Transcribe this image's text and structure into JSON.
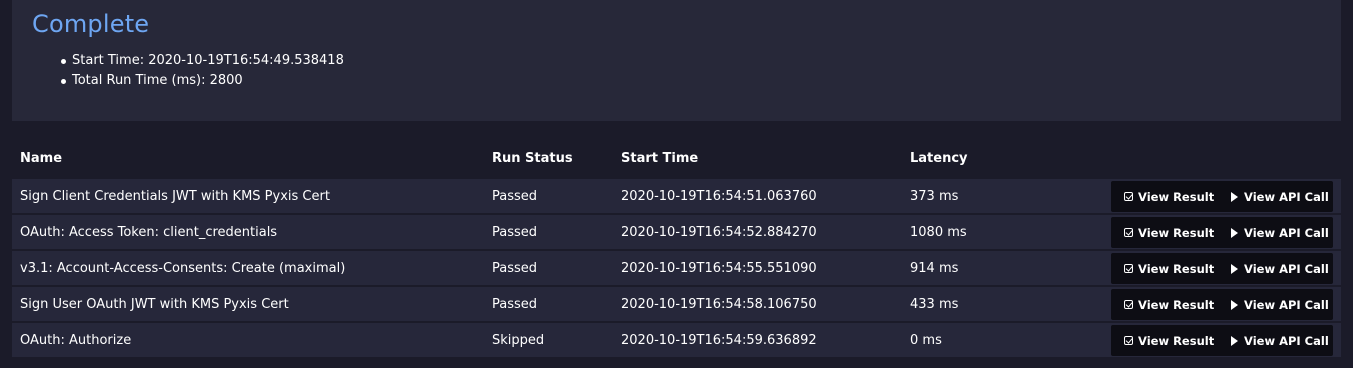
{
  "summary": {
    "status_title": "Complete",
    "start_time_label": "Start Time: 2020-10-19T16:54:49.538418",
    "total_run_time_label": "Total Run Time (ms): 2800"
  },
  "table": {
    "headers": {
      "name": "Name",
      "run_status": "Run Status",
      "start_time": "Start Time",
      "latency": "Latency"
    },
    "rows": [
      {
        "name": "Sign Client Credentials JWT with KMS Pyxis Cert",
        "status": "Passed",
        "start_time": "2020-10-19T16:54:51.063760",
        "latency": "373 ms"
      },
      {
        "name": "OAuth: Access Token: client_credentials",
        "status": "Passed",
        "start_time": "2020-10-19T16:54:52.884270",
        "latency": "1080 ms"
      },
      {
        "name": "v3.1: Account-Access-Consents: Create (maximal)",
        "status": "Passed",
        "start_time": "2020-10-19T16:54:55.551090",
        "latency": "914 ms"
      },
      {
        "name": "Sign User OAuth JWT with KMS Pyxis Cert",
        "status": "Passed",
        "start_time": "2020-10-19T16:54:58.106750",
        "latency": "433 ms"
      },
      {
        "name": "OAuth: Authorize",
        "status": "Skipped",
        "start_time": "2020-10-19T16:54:59.636892",
        "latency": "0 ms"
      }
    ],
    "actions": {
      "view_result_label": "View Result",
      "view_api_call_label": "View API Call",
      "view_result_icon": "check-square-icon",
      "view_api_call_icon": "play-icon"
    }
  },
  "colors": {
    "accent": "#6ea6f2",
    "background": "#1b1b29",
    "panel": "#272839",
    "row": "#26273a",
    "button_group": "#0d0d14"
  }
}
